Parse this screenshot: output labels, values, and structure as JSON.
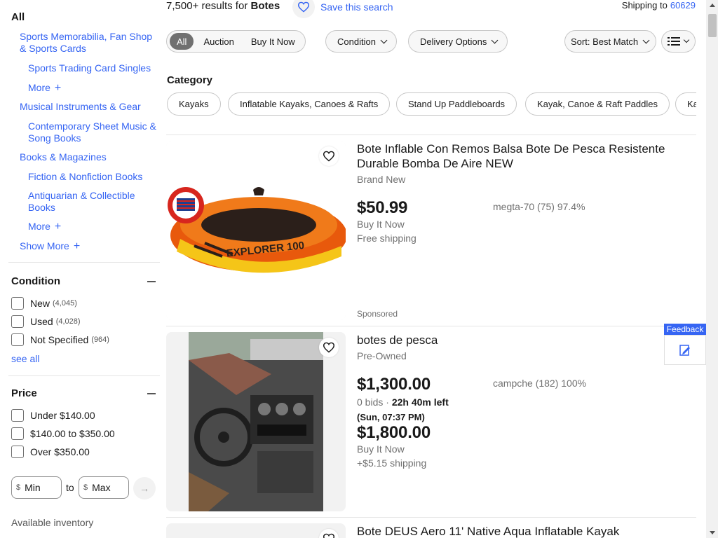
{
  "search": {
    "results_prefix": "7,500+ results for",
    "query": "Botes",
    "save_label": "Save this search",
    "shipping_label": "Shipping to",
    "zip": "60629"
  },
  "sidebar": {
    "all_label": "All",
    "categories": [
      "Sports Memorabilia, Fan Shop & Sports Cards",
      "Sports Trading Card Singles",
      "More",
      "Musical Instruments & Gear",
      "Contemporary Sheet Music & Song Books",
      "Books & Magazines",
      "Fiction & Nonfiction Books",
      "Antiquarian & Collectible Books",
      "More",
      "Show More"
    ],
    "condition": {
      "title": "Condition",
      "options": [
        {
          "label": "New",
          "count": "(4,045)"
        },
        {
          "label": "Used",
          "count": "(4,028)"
        },
        {
          "label": "Not Specified",
          "count": "(964)"
        }
      ],
      "see_all": "see all"
    },
    "price": {
      "title": "Price",
      "options": [
        "Under $140.00",
        "$140.00 to $350.00",
        "Over $350.00"
      ],
      "currency": "$",
      "min_placeholder": "Min",
      "max_placeholder": "Max",
      "to_label": "to"
    },
    "available_inventory": "Available inventory"
  },
  "filters": {
    "format": [
      "All",
      "Auction",
      "Buy It Now"
    ],
    "condition": "Condition",
    "delivery": "Delivery Options",
    "sort": "Sort: Best Match"
  },
  "category": {
    "title": "Category",
    "pills": [
      "Kayaks",
      "Inflatable Kayaks, Canoes & Rafts",
      "Stand Up Paddleboards",
      "Kayak, Canoe & Raft Paddles",
      "Kayak Accessories"
    ]
  },
  "listings": [
    {
      "title": "Bote Inflable Con Remos Balsa Bote De Pesca Resistente Durable Bomba De Aire NEW",
      "condition": "Brand New",
      "price": "$50.99",
      "format": "Buy It Now",
      "shipping": "Free shipping",
      "seller": "megta-70 (75) 97.4%",
      "sponsored": "Sponsored",
      "badge_text": "FREE SHIPPING",
      "boat_text": "EXPLORER 100"
    },
    {
      "title": "botes de pesca",
      "condition": "Pre-Owned",
      "price": "$1,300.00",
      "bids": "0 bids · ",
      "time_left": "22h 40m left",
      "end_time": "(Sun, 07:37 PM)",
      "bin_price": "$1,800.00",
      "format": "Buy It Now",
      "shipping": "+$5.15 shipping",
      "seller": "campche (182) 100%"
    },
    {
      "title": "Bote DEUS Aero 11' Native Aqua Inflatable Kayak"
    }
  ],
  "feedback": {
    "label": "Feedback"
  },
  "colors": {
    "link": "#3665f3",
    "text": "#191919",
    "muted": "#707070"
  }
}
